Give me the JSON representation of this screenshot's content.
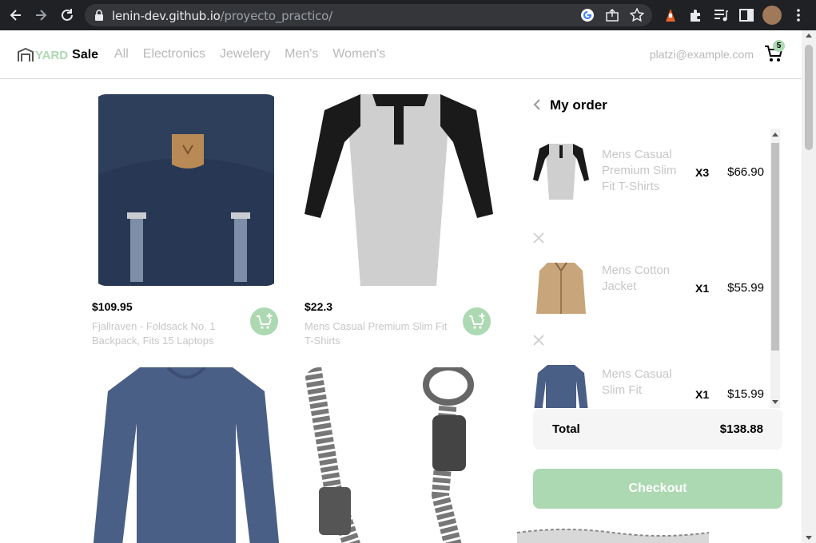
{
  "browser": {
    "url_host": "lenin-dev.github.io",
    "url_path": "/proyecto_practico/"
  },
  "header": {
    "logo_yard": "YARD",
    "logo_sale": "Sale",
    "categories": [
      "All",
      "Electronics",
      "Jewelery",
      "Men's",
      "Women's"
    ],
    "email": "platzi@example.com",
    "cart_count": "5"
  },
  "products": [
    {
      "price": "$109.95",
      "name": "Fjallraven - Foldsack No. 1 Backpack, Fits 15 Laptops",
      "image": "navy-backpack"
    },
    {
      "price": "$22.3",
      "name": "Mens Casual Premium Slim Fit T-Shirts",
      "image": "raglan-tshirt"
    },
    {
      "price": "",
      "name": "",
      "image": "navy-longsleeve"
    },
    {
      "price": "",
      "name": "",
      "image": "silver-chain-bracelet"
    }
  ],
  "order": {
    "title": "My order",
    "items": [
      {
        "name": "Mens Casual Premium Slim Fit T-Shirts",
        "qty": "X3",
        "price": "$66.90",
        "image": "raglan-tshirt"
      },
      {
        "name": "Mens Cotton Jacket",
        "qty": "X1",
        "price": "$55.99",
        "image": "tan-jacket"
      },
      {
        "name": "Mens Casual Slim Fit",
        "qty": "X1",
        "price": "$15.99",
        "image": "navy-longsleeve"
      }
    ],
    "total_label": "Total",
    "total_amount": "$138.88",
    "checkout_label": "Checkout"
  },
  "colors": {
    "accent_green": "#acd9b2",
    "muted_text": "#c7c7c7",
    "chrome_bg": "#202124"
  }
}
